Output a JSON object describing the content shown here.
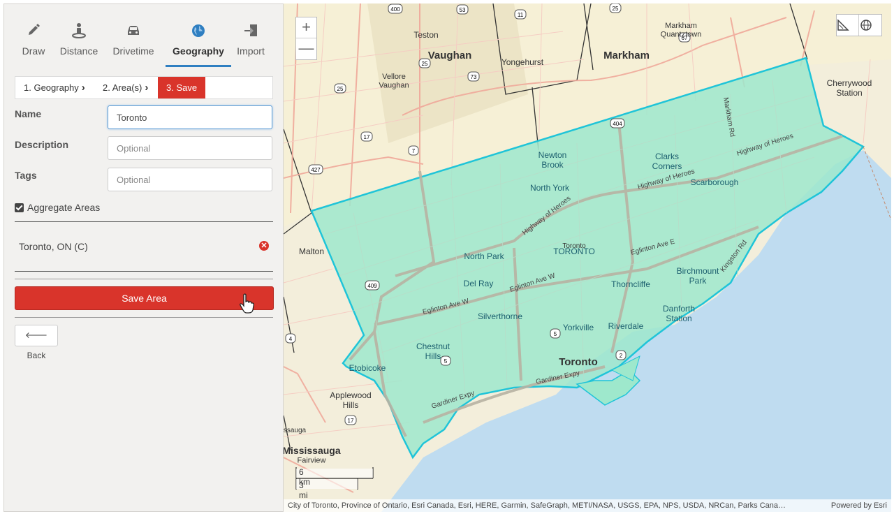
{
  "tabs": [
    {
      "label": "Draw",
      "icon": "pencil-icon"
    },
    {
      "label": "Distance",
      "icon": "person-pin-icon"
    },
    {
      "label": "Drivetime",
      "icon": "car-icon"
    },
    {
      "label": "Geography",
      "icon": "globe-icon"
    },
    {
      "label": "Import",
      "icon": "import-icon"
    }
  ],
  "steps": [
    "1. Geography",
    "2. Area(s)",
    "3. Save"
  ],
  "form": {
    "name_label": "Name",
    "name_value": "Toronto",
    "description_label": "Description",
    "description_placeholder": "Optional",
    "tags_label": "Tags",
    "tags_placeholder": "Optional",
    "aggregate_label": "Aggregate Areas"
  },
  "areas": [
    "Toronto, ON (C)"
  ],
  "buttons": {
    "save": "Save Area",
    "back": "Back"
  },
  "map": {
    "zoom_in": "+",
    "zoom_out": "—",
    "scale_km": "6 km",
    "scale_mi": "3 mi",
    "attribution": "City of Toronto, Province of Ontario, Esri Canada, Esri, HERE, Garmin, SafeGraph, METI/NASA, USGS, EPA, NPS, USDA, NRCan, Parks Cana…",
    "powered_by": "Powered by Esri",
    "labels": [
      "Teston",
      "Vaughan",
      "Yongehurst",
      "Markham",
      "Markham Quantztown",
      "Vellore Vaughan",
      "Cherrywood Station",
      "Newton Brook",
      "Clarks Corners",
      "North York",
      "Scarborough",
      "Malton",
      "North Park",
      "Toronto",
      "TORONTO",
      "Del Ray",
      "Birchmount Park",
      "Thorncliffe",
      "Silverthorne",
      "Danforth Station",
      "Yorkville",
      "Riverdale",
      "Chestnut Hills",
      "Etobicoke",
      "Toronto",
      "Applewood Hills",
      "Mississauga Fairview",
      "ssauga"
    ],
    "roads": [
      "Highway of Heroes",
      "Highway of Heroes",
      "Highway of Heroes",
      "Eglinton Ave E",
      "Eglinton Ave W",
      "Eglinton Ave W",
      "Gardiner Expy",
      "Gardiner Expy",
      "Kingston Rd",
      "Markham Rd"
    ],
    "shields": [
      "400",
      "53",
      "25",
      "11",
      "7",
      "73",
      "25",
      "17",
      "427",
      "404",
      "409",
      "5",
      "5",
      "2",
      "4",
      "17",
      "25",
      "67"
    ],
    "colors": {
      "polygon_fill": "#9ee8cc",
      "polygon_stroke": "#1fc4d8",
      "water": "#bfdcf0",
      "accent_red": "#d9342b",
      "tab_blue": "#2f7fc1"
    }
  }
}
